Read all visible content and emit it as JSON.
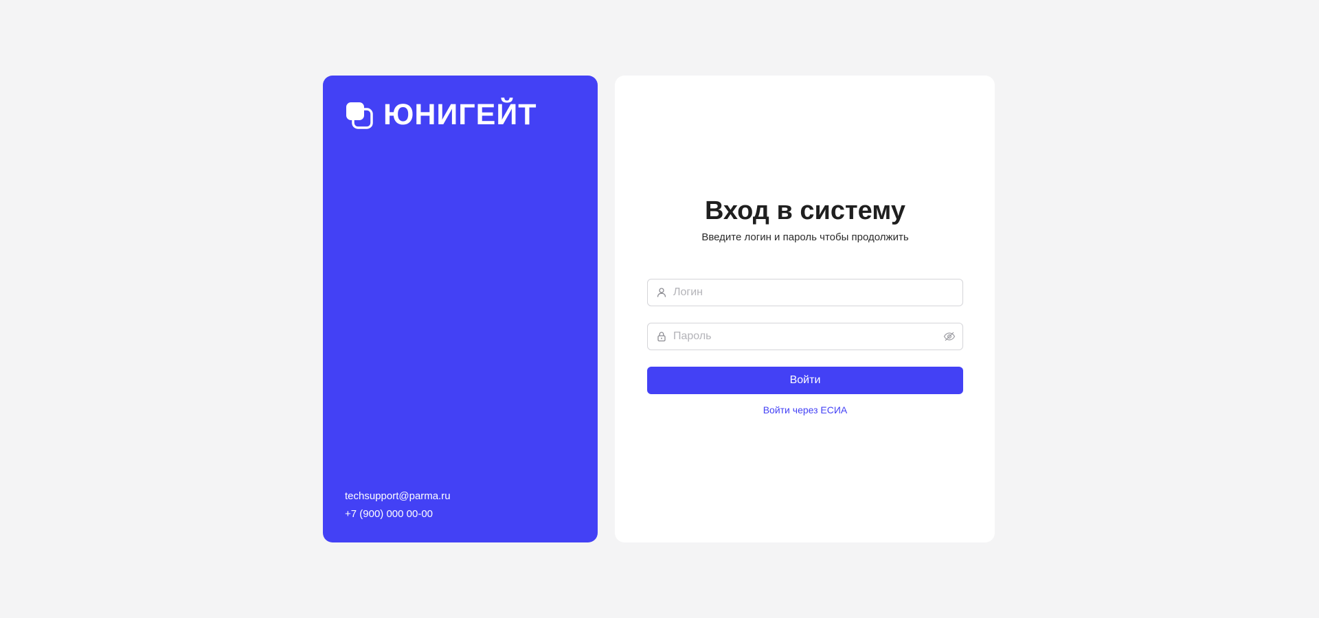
{
  "brand": {
    "name": "ЮНИГЕЙТ",
    "logo_icon": "stacked-squares-logo-icon",
    "accent_color": "#4341f5",
    "contacts": {
      "email": "techsupport@parma.ru",
      "phone": "+7 (900) 000 00-00"
    }
  },
  "login": {
    "title": "Вход в систему",
    "subtitle": "Введите логин и пароль чтобы продолжить",
    "username": {
      "value": "",
      "placeholder": "Логин",
      "icon": "user-icon"
    },
    "password": {
      "value": "",
      "placeholder": "Пароль",
      "icon": "lock-icon",
      "toggle_icon": "eye-off-icon"
    },
    "submit_label": "Войти",
    "esia_link_label": "Войти через ЕСИА"
  }
}
